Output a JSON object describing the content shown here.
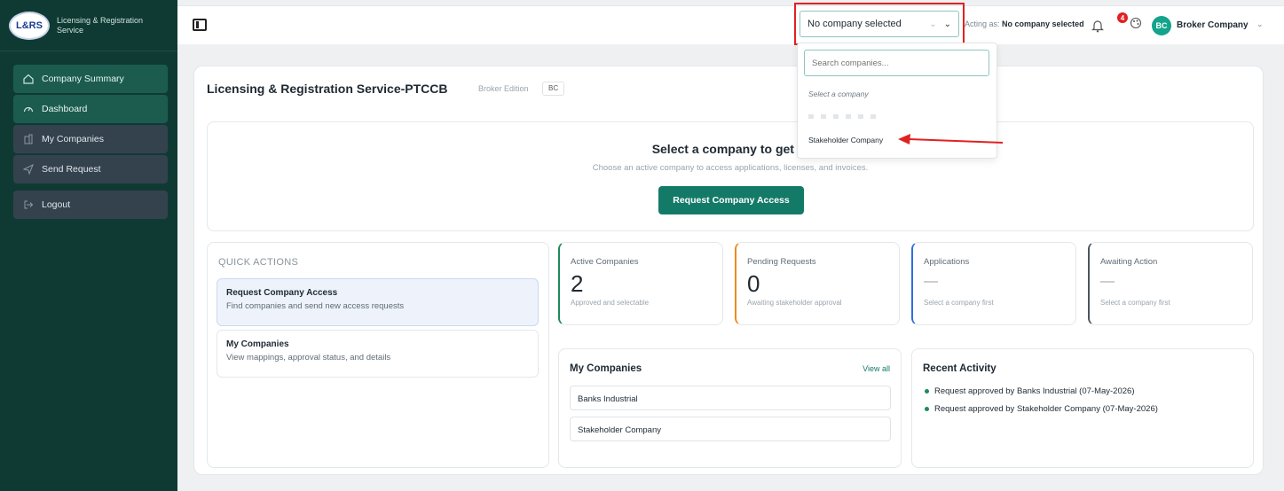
{
  "brand": {
    "logo_text": "L&RS",
    "name": "Licensing & Registration Service"
  },
  "sidebar": {
    "items": [
      {
        "label": "Company Summary",
        "icon": "home-icon"
      },
      {
        "label": "Dashboard",
        "icon": "gauge-icon"
      },
      {
        "label": "My Companies",
        "icon": "building-icon"
      },
      {
        "label": "Send Request",
        "icon": "send-icon"
      },
      {
        "label": "Logout",
        "icon": "logout-icon"
      }
    ]
  },
  "topbar": {
    "company_select_value": "No company selected",
    "acting_prefix": "Acting as:",
    "acting_value": "No company selected",
    "notification_count": "4",
    "avatar_initials": "BC",
    "user_name": "Broker Company"
  },
  "dropdown": {
    "search_placeholder": "Search companies...",
    "hint": "Select a company",
    "option": "Stakeholder Company"
  },
  "page": {
    "title": "Licensing & Registration Service-PTCCB",
    "edition": "Broker Edition",
    "edition_badge": "BC"
  },
  "hero": {
    "title": "Select a company to get st",
    "subtitle": "Choose an active company to access applications, licenses, and invoices.",
    "button": "Request Company Access"
  },
  "quick_actions": {
    "heading": "QUICK ACTIONS",
    "items": [
      {
        "title": "Request Company Access",
        "desc": "Find companies and send new access requests"
      },
      {
        "title": "My Companies",
        "desc": "View mappings, approval status, and details"
      }
    ]
  },
  "stats": [
    {
      "label": "Active Companies",
      "value": "2",
      "sub": "Approved and selectable",
      "accent": "#1f8a5a"
    },
    {
      "label": "Pending Requests",
      "value": "0",
      "sub": "Awaiting stakeholder approval",
      "accent": "#f08a1c"
    },
    {
      "label": "Applications",
      "value": "—",
      "sub": "Select a company first",
      "accent": "#2f6fe0"
    },
    {
      "label": "Awaiting Action",
      "value": "—",
      "sub": "Select a company first",
      "accent": "#4b5560"
    }
  ],
  "my_companies": {
    "heading": "My Companies",
    "view_all": "View all",
    "rows": [
      "Banks Industrial",
      "Stakeholder Company"
    ]
  },
  "recent_activity": {
    "heading": "Recent Activity",
    "items": [
      "Request approved by Banks Industrial (07-May-2026)",
      "Request approved by Stakeholder Company (07-May-2026)"
    ]
  }
}
